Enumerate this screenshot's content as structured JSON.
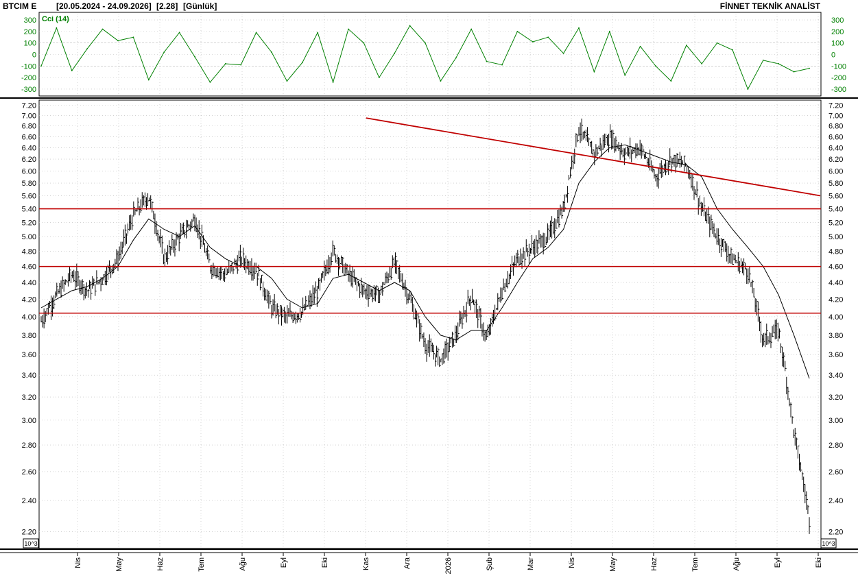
{
  "header": {
    "ticker": "BTCIM E",
    "range": "[20.05.2024 - 24.09.2026]",
    "last": "[2.28]",
    "period": "[Günlük]",
    "brand": "FİNNET TEKNİK ANALİST"
  },
  "colors": {
    "cci": "#008000",
    "price": "#000000",
    "resistance": "#c00000",
    "grid": "#b8b8b8"
  },
  "chart_data": [
    {
      "type": "line",
      "title": "Cci (14)",
      "ylim": [
        -330,
        330
      ],
      "yticks": [
        -300,
        -200,
        -100,
        0,
        100,
        200,
        300
      ],
      "dashed_levels": [
        100,
        -100
      ],
      "x": [
        0,
        2,
        4,
        6,
        8,
        10,
        12,
        14,
        16,
        18,
        20,
        22,
        24,
        26,
        28,
        30,
        32,
        34,
        36,
        38,
        40,
        42,
        44,
        46,
        48,
        50,
        52,
        54,
        56,
        58,
        60,
        62,
        64,
        66,
        68,
        70,
        72,
        74,
        76,
        78,
        80,
        82,
        84,
        86,
        88,
        90,
        92,
        94,
        96,
        98,
        100
      ],
      "series": [
        {
          "values": [
            -100,
            230,
            -140,
            50,
            220,
            120,
            150,
            -220,
            20,
            190,
            -20,
            -240,
            -80,
            -90,
            190,
            20,
            -230,
            -70,
            190,
            -240,
            220,
            100,
            -200,
            10,
            250,
            100,
            -230,
            -30,
            220,
            -60,
            -90,
            200,
            110,
            150,
            10,
            230,
            -150,
            200,
            -180,
            70,
            -100,
            -230,
            80,
            -80,
            100,
            40,
            -300,
            -50,
            -80,
            -150,
            -120
          ]
        }
      ]
    },
    {
      "type": "line",
      "title": "",
      "y_scale": "log",
      "ylim": [
        2.12,
        7.25
      ],
      "yticks": [
        2.2,
        2.4,
        2.6,
        2.8,
        3.0,
        3.2,
        3.4,
        3.6,
        3.8,
        4.0,
        4.2,
        4.4,
        4.6,
        4.8,
        5.0,
        5.2,
        5.4,
        5.6,
        5.8,
        6.0,
        6.2,
        6.4,
        6.6,
        6.8,
        7.0,
        7.2
      ],
      "x_ticks": [
        "Nis",
        "May",
        "Haz",
        "Tem",
        "Ağu",
        "Eyl",
        "Eki",
        "Kas",
        "Ara",
        "2026",
        "Şub",
        "Mar",
        "Nis",
        "May",
        "Haz",
        "Tem",
        "Ağu",
        "Eyl",
        "Eki"
      ],
      "x": [
        0,
        2,
        4,
        6,
        8,
        10,
        12,
        14,
        16,
        18,
        20,
        22,
        24,
        26,
        28,
        30,
        32,
        34,
        36,
        38,
        40,
        42,
        44,
        46,
        48,
        50,
        52,
        54,
        56,
        58,
        60,
        62,
        64,
        66,
        68,
        70,
        72,
        74,
        76,
        78,
        80,
        82,
        84,
        86,
        88,
        90,
        92,
        94,
        96,
        98,
        100
      ],
      "series": [
        {
          "name": "",
          "values": [
            3.95,
            4.25,
            4.5,
            4.3,
            4.45,
            4.7,
            5.3,
            5.6,
            4.7,
            5.0,
            5.25,
            4.6,
            4.5,
            4.7,
            4.55,
            4.1,
            4.0,
            4.05,
            4.3,
            4.8,
            4.5,
            4.3,
            4.25,
            4.65,
            4.2,
            3.7,
            3.55,
            3.8,
            4.25,
            3.75,
            4.3,
            4.7,
            4.85,
            5.0,
            5.4,
            6.75,
            6.3,
            6.6,
            6.3,
            6.4,
            5.9,
            6.2,
            6.1,
            5.4,
            5.0,
            4.7,
            4.55,
            3.75,
            3.85,
            2.9,
            2.28
          ]
        },
        {
          "name": "",
          "values": [
            4.1,
            4.2,
            4.3,
            4.35,
            4.45,
            4.6,
            4.95,
            5.25,
            5.1,
            5.0,
            5.15,
            4.85,
            4.7,
            4.6,
            4.6,
            4.45,
            4.2,
            4.1,
            4.15,
            4.45,
            4.5,
            4.4,
            4.3,
            4.4,
            4.3,
            4.0,
            3.8,
            3.75,
            3.85,
            3.85,
            4.1,
            4.4,
            4.7,
            4.85,
            5.1,
            5.8,
            6.15,
            6.4,
            6.45,
            6.35,
            6.25,
            6.15,
            6.1,
            5.9,
            5.4,
            5.1,
            4.85,
            4.6,
            4.25,
            3.8,
            3.37
          ]
        }
      ],
      "horizontal_levels": [
        5.4,
        4.6,
        4.04
      ],
      "trendline": {
        "from": [
          42.3,
          6.95
        ],
        "to": [
          100,
          5.6
        ]
      }
    }
  ]
}
